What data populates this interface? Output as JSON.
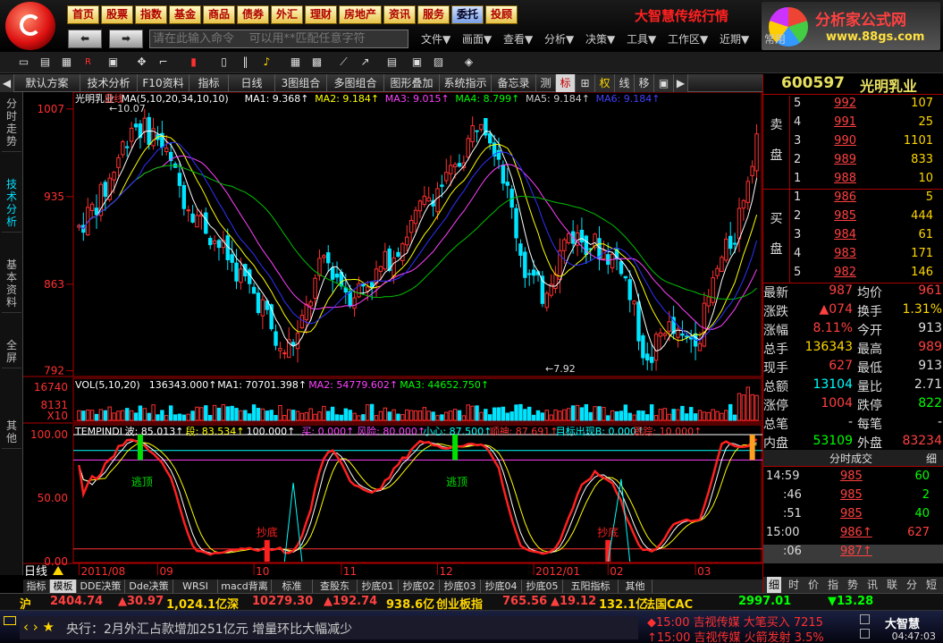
{
  "menu": {
    "buttons": [
      "首页",
      "股票",
      "指数",
      "基金",
      "商品",
      "债券",
      "外汇",
      "理财",
      "房地产",
      "资讯",
      "服务",
      "委托",
      "投顾"
    ],
    "brand_title": "大智慧传统行情",
    "brand_name": "分析家公式网",
    "brand_url": "www.88gs.com",
    "command_placeholder": "请在此输入命令    可以用**匹配任意字符",
    "menu_items": [
      "文件▼",
      "画面▼",
      "查看▼",
      "分析▼",
      "决策▼",
      "工具▼",
      "工作区▼",
      "近期▼",
      "常用"
    ]
  },
  "toolbar_icons": [
    "folder-icon",
    "save-icon",
    "grid-icon",
    "rsi-icon",
    "window-icon",
    "cursor-icon",
    "draw-icon",
    "candle-icon",
    "bar-icon",
    "columns-icon",
    "bell-icon",
    "chart-icon",
    "picture-icon",
    "line-tool-icon",
    "trend-icon",
    "doc-icon",
    "info-icon",
    "report-icon",
    "coin-icon"
  ],
  "chart_tabs": [
    "◀",
    "默认方案",
    "技术分析",
    "F10资料",
    "指标",
    "日线",
    "3图组合",
    "多图组合",
    "图形叠加",
    "系统指示",
    "备忘录",
    "测",
    "标",
    "⊞",
    "权",
    "线",
    "移",
    "▣",
    "▶"
  ],
  "left_tabs": [
    "分时走势",
    "技术分析",
    "基本资料",
    "全屏",
    "其他"
  ],
  "main_panel": {
    "stock_label": "光明乳业",
    "period_label": "日线",
    "ma_header": "MA(5,10,20,34,10,10)",
    "ma_values": [
      {
        "label": "MA1:",
        "value": "9.368",
        "color": "#ffffff"
      },
      {
        "label": "MA2:",
        "value": "9.184",
        "color": "#ffff00"
      },
      {
        "label": "MA3:",
        "value": "9.015",
        "color": "#ff40ff"
      },
      {
        "label": "MA4:",
        "value": "8.799",
        "color": "#00ff00"
      },
      {
        "label": "MA5:",
        "value": "9.184",
        "color": "#cccccc"
      },
      {
        "label": "MA6:",
        "value": "9.184",
        "color": "#4040ff"
      }
    ],
    "price_ticks": [
      "1007",
      "935",
      "863",
      "792"
    ],
    "high_marker": "10.07",
    "low_marker": "7.92",
    "vol_header": "VOL(5,10,20)",
    "vol_values": [
      {
        "label": "",
        "value": "136343.000",
        "color": "#ffffff"
      },
      {
        "label": "MA1:",
        "value": "70701.398",
        "color": "#ffffff"
      },
      {
        "label": "MA2:",
        "value": "54779.602",
        "color": "#ff40ff"
      },
      {
        "label": "MA3:",
        "value": "44652.750",
        "color": "#00ff00"
      }
    ],
    "vol_ticks": [
      "16740",
      "8131",
      "X10"
    ],
    "ind_header": "TEMPINDI",
    "ind_values": [
      {
        "label": "波:",
        "value": "85.013",
        "color": "#ffffff"
      },
      {
        "label": "段:",
        "value": "83.534",
        "color": "#ffff00"
      },
      {
        "label": "",
        "value": "100.000",
        "color": "#ffffff"
      },
      {
        "label": "买:",
        "value": "0.000",
        "color": "#ff40ff"
      },
      {
        "label": "风险:",
        "value": "80.000",
        "color": "#ff40ff"
      },
      {
        "label": "小心:",
        "value": "87.500",
        "color": "#00ffff"
      },
      {
        "label": "顺神:",
        "value": "87.691",
        "color": "#ff3030"
      },
      {
        "label": "目标出现B:",
        "value": "0.000",
        "color": "#00ffff"
      },
      {
        "label": "跟踪:",
        "value": "10.000",
        "color": "#ff3030"
      }
    ],
    "ind_ticks": [
      "100.00",
      "50.00",
      "0.00"
    ],
    "ind_labels": {
      "top1": "逃顶",
      "top2": "逃顶",
      "bottom1": "抄底",
      "bottom2": "抄底"
    },
    "date_labels": [
      "2011/08",
      "09",
      "10",
      "11",
      "12",
      "2012/01",
      "02",
      "03"
    ],
    "period_button": "日线"
  },
  "bottom_tabs": [
    "指标",
    "模板",
    "DDE决策",
    "Dde决策",
    "WRSI",
    "macd背离",
    "标准",
    "查股东",
    "抄底01",
    "抄底02",
    "抄底03",
    "抄底04",
    "抄底05",
    "五阳指标",
    "其他"
  ],
  "quote": {
    "code": "600597",
    "name": "光明乳业",
    "sell_label": "卖盘",
    "buy_label": "买盘",
    "asks": [
      {
        "level": "5",
        "price": "992",
        "vol": "107"
      },
      {
        "level": "4",
        "price": "991",
        "vol": "25"
      },
      {
        "level": "3",
        "price": "990",
        "vol": "1101"
      },
      {
        "level": "2",
        "price": "989",
        "vol": "833"
      },
      {
        "level": "1",
        "price": "988",
        "vol": "10"
      }
    ],
    "bids": [
      {
        "level": "1",
        "price": "986",
        "vol": "5"
      },
      {
        "level": "2",
        "price": "985",
        "vol": "444"
      },
      {
        "level": "3",
        "price": "984",
        "vol": "61"
      },
      {
        "level": "4",
        "price": "983",
        "vol": "171"
      },
      {
        "level": "5",
        "price": "982",
        "vol": "146"
      }
    ],
    "stats": [
      {
        "k1": "最新",
        "v1": "987",
        "c1": "#ff4040",
        "k2": "均价",
        "v2": "961",
        "c2": "#ff4040"
      },
      {
        "k1": "涨跌",
        "v1": "▲074",
        "c1": "#ff4040",
        "k2": "换手",
        "v2": "1.31%",
        "c2": "#ffd700"
      },
      {
        "k1": "涨幅",
        "v1": "8.11%",
        "c1": "#ff4040",
        "k2": "今开",
        "v2": "913",
        "c2": "#dddddd"
      },
      {
        "k1": "总手",
        "v1": "136343",
        "c1": "#ffd700",
        "k2": "最高",
        "v2": "989",
        "c2": "#ff4040"
      },
      {
        "k1": "现手",
        "v1": "627",
        "c1": "#ff4040",
        "k2": "最低",
        "v2": "913",
        "c2": "#dddddd"
      },
      {
        "k1": "总额",
        "v1": "13104",
        "c1": "#00ffff",
        "k2": "量比",
        "v2": "2.71",
        "c2": "#dddddd"
      },
      {
        "k1": "涨停",
        "v1": "1004",
        "c1": "#ff4040",
        "k2": "跌停",
        "v2": "822",
        "c2": "#00ff00"
      },
      {
        "k1": "总笔",
        "v1": "-",
        "c1": "#dddddd",
        "k2": "每笔",
        "v2": "-",
        "c2": "#dddddd"
      },
      {
        "k1": "内盘",
        "v1": "53109",
        "c1": "#00ff00",
        "k2": "外盘",
        "v2": "83234",
        "c2": "#ff4040"
      }
    ],
    "tick_title": "分时成交",
    "tick_detail": "细",
    "ticks": [
      {
        "time": "14:59",
        "price": "985",
        "vol": "60",
        "vc": "#00ff00"
      },
      {
        "time": ":46",
        "price": "985",
        "vol": "2",
        "vc": "#00ff00"
      },
      {
        "time": ":51",
        "price": "985",
        "vol": "40",
        "vc": "#00ff00"
      },
      {
        "time": "15:00",
        "price": "986↑",
        "vol": "627",
        "vc": "#ff4040"
      },
      {
        "time": ":06",
        "price": "987↑",
        "vol": "",
        "vc": "#ff4040"
      }
    ],
    "right_tabs": [
      "细",
      "时",
      "价",
      "指",
      "势",
      "讯",
      "联",
      "分",
      "短"
    ]
  },
  "ticker": {
    "items": [
      {
        "text": "沪",
        "color": "#ffd700"
      },
      {
        "text": "2404.74",
        "color": "#ff4040"
      },
      {
        "text": "▲30.97",
        "color": "#ff4040"
      },
      {
        "text": "1,024.1亿",
        "color": "#ffd700"
      },
      {
        "text": "深",
        "color": "#ffd700"
      },
      {
        "text": "10279.30",
        "color": "#ff4040"
      },
      {
        "text": "▲192.74",
        "color": "#ff4040"
      },
      {
        "text": "938.6亿",
        "color": "#ffd700"
      },
      {
        "text": "创业板指",
        "color": "#ffd700"
      },
      {
        "text": "765.56",
        "color": "#ff4040"
      },
      {
        "text": "▲19.12",
        "color": "#ff4040"
      },
      {
        "text": "132.1亿",
        "color": "#ffd700"
      },
      {
        "text": "法国CAC",
        "color": "#ffd700"
      },
      {
        "text": "2997.01",
        "color": "#00ff00"
      },
      {
        "text": "▼13.28",
        "color": "#00ff00"
      }
    ]
  },
  "news": {
    "controls": "‹ › ★",
    "text": "央行：2月外汇占款增加251亿元 增量环比大幅减少",
    "alerts": [
      "◆15:00 吉视传媒  大笔买入 7215",
      "↑15:00 吉视传媒  火箭发射 3.5%"
    ],
    "clock": "04:47:03",
    "small_logo": "大智慧"
  },
  "colors": {
    "up": "#ff3030",
    "down": "#00e5ff",
    "frame": "#b00000",
    "ma5": "#ffffff",
    "ma10": "#ffff00",
    "ma20": "#ff40ff",
    "ma34": "#00c000",
    "ma_blue": "#3030ff"
  }
}
